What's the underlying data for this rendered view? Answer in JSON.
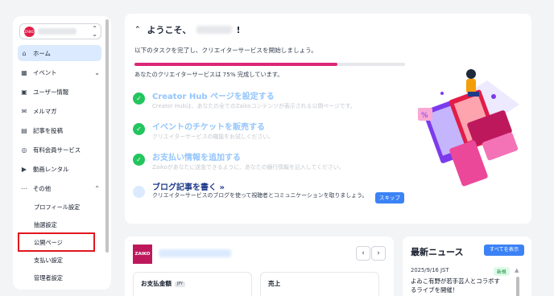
{
  "sidebar": {
    "account_logo": "ZAIKO",
    "items": [
      {
        "label": "ホーム",
        "icon": "home-icon"
      },
      {
        "label": "イベント",
        "icon": "calendar-icon"
      },
      {
        "label": "ユーザー情報",
        "icon": "user-icon"
      },
      {
        "label": "メルマガ",
        "icon": "mail-icon"
      },
      {
        "label": "記事を投稿",
        "icon": "document-icon"
      },
      {
        "label": "有料会員サービス",
        "icon": "membership-icon"
      },
      {
        "label": "動画レンタル",
        "icon": "video-icon"
      },
      {
        "label": "その他",
        "icon": "more-icon"
      }
    ],
    "subitems": [
      "プロフィール設定",
      "抽選設定",
      "公開ページ",
      "支払い設定",
      "管理者設定"
    ]
  },
  "welcome": {
    "greeting": "ようこそ、",
    "greeting_end": "!",
    "intro": "以下のタスクを完了し、クリエイターサービスを開始しましょう。",
    "progress_percent": 75,
    "progress_text": "あなたのクリエイターサービスは 75% 完成しています。",
    "tasks": [
      {
        "title": "Creator Hub ページを設定する",
        "desc": "Creator Hubは、あなたの全てのZaikoコンテンツが表示される公開ページです。",
        "done": true
      },
      {
        "title": "イベントのチケットを販売する",
        "desc": "クリエイターサービスの機能をお試しください。",
        "done": true
      },
      {
        "title": "お支払い情報を追加する",
        "desc": "Zaikoがあなたに送金できるように、あなたの銀行情報を記入してください。",
        "done": true
      },
      {
        "title": "ブログ記事を書く",
        "title_arrow": "»",
        "desc": "クリエイターサービスのブログを使って視聴者とコミュニケーションを取りましょう。",
        "done": false
      }
    ],
    "skip_label": "スキップ"
  },
  "account_card": {
    "logo": "ZAIKO",
    "prev": "‹",
    "next": "›",
    "stat_payment_label": "お支払金額",
    "currency": "JPY",
    "stat_sales_label": "売上"
  },
  "news": {
    "title": "最新ニュース",
    "view_all": "すべてを表示",
    "date": "2025/9/16 JST",
    "badge": "新規",
    "text": "よゐこ有野が若手芸人とコラボするライブを開催！"
  },
  "colors": {
    "accent": "#3b82f6",
    "progress": "#db2777",
    "check": "#22c55e",
    "highlight": "#e0161e"
  }
}
